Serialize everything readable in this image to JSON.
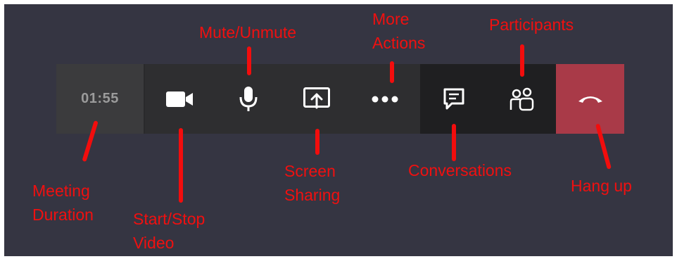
{
  "meeting": {
    "duration": "01:55"
  },
  "controls": [
    {
      "id": "video",
      "icon": "video-camera-icon"
    },
    {
      "id": "mute",
      "icon": "microphone-icon"
    },
    {
      "id": "share",
      "icon": "screen-share-icon"
    },
    {
      "id": "more",
      "icon": "more-dots-icon"
    },
    {
      "id": "chat",
      "icon": "chat-icon"
    },
    {
      "id": "participants",
      "icon": "participants-icon"
    },
    {
      "id": "hangup",
      "icon": "phone-hangup-icon"
    }
  ],
  "annotations": {
    "meeting_duration": "Meeting\nDuration",
    "start_stop_video": "Start/Stop\nVideo",
    "mute_unmute": "Mute/Unmute",
    "screen_sharing": "Screen\nSharing",
    "more_actions": "More\nActions",
    "conversations": "Conversations",
    "participants": "Participants",
    "hang_up": "Hang up"
  },
  "colors": {
    "background": "#353542",
    "annotation": "#f01010",
    "hangup": "#a93a48",
    "icon": "#ffffff"
  }
}
